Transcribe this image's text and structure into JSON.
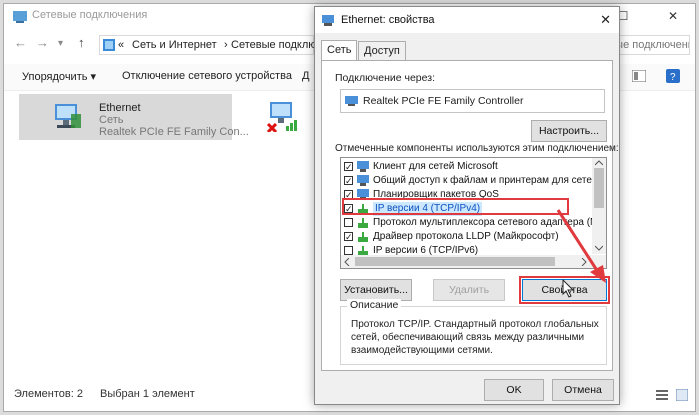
{
  "explorer": {
    "title": "Сетевые подключения",
    "window_buttons": [
      "—",
      "☐",
      "✕"
    ],
    "nav": [
      "←",
      "→",
      "▾",
      "↑"
    ],
    "breadcrumb": [
      "«",
      "Сеть и Интернет",
      "›",
      "Сетевые подключ"
    ],
    "search_placeholder": "Поиск: Сетевые подключения",
    "toolbar": {
      "organize": "Упорядочить ▾",
      "disable": "Отключение сетевого устройства",
      "more": "Д"
    },
    "items": [
      {
        "name": "Ethernet",
        "network": "Сеть",
        "adapter": "Realtek PCIe FE Family Con..."
      }
    ],
    "status": {
      "count": "Элементов: 2",
      "selected": "Выбран 1 элемент"
    }
  },
  "dialog": {
    "title": "Ethernet: свойства",
    "close": "✕",
    "tabs": [
      "Сеть",
      "Доступ"
    ],
    "connect_using_label": "Подключение через:",
    "adapter": "Realtek PCIe FE Family Controller",
    "configure_button": "Настроить...",
    "components_label": "Отмеченные компоненты используются этим подключением:",
    "components": [
      {
        "label": "Клиент для сетей Microsoft",
        "checked": true
      },
      {
        "label": "Общий доступ к файлам и принтерам для сетей Mi",
        "checked": true
      },
      {
        "label": "Планировщик пакетов QoS",
        "checked": true
      },
      {
        "label": "IP версии 4 (TCP/IPv4)",
        "checked": true,
        "selected": true
      },
      {
        "label": "Протокол мультиплексора сетевого адаптера (Май",
        "checked": false
      },
      {
        "label": "Драйвер протокола LLDP (Майкрософт)",
        "checked": true
      },
      {
        "label": "IP версии 6 (TCP/IPv6)",
        "checked": false
      }
    ],
    "install_button": "Установить...",
    "uninstall_button": "Удалить",
    "properties_button": "Свойства",
    "description_legend": "Описание",
    "description_lines": [
      "Протокол TCP/IP. Стандартный протокол глобальных",
      "сетей, обеспечивающий связь между различными",
      "взаимодействующими сетями."
    ],
    "ok_button": "OK",
    "cancel_button": "Отмена"
  },
  "colors": {
    "annotation_red": "#e0393e",
    "selection_bg": "#cce8ff"
  }
}
